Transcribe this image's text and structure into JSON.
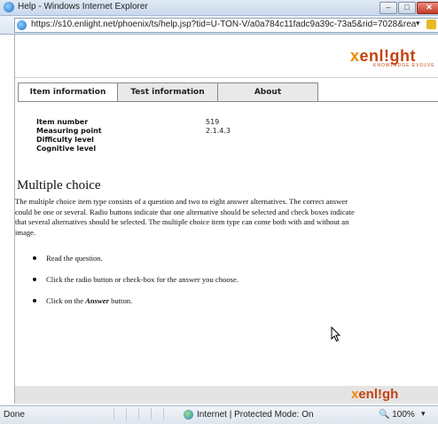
{
  "window": {
    "title": "Help - Windows Internet Explorer",
    "min_glyph": "–",
    "max_glyph": "□",
    "close_glyph": "✕"
  },
  "address": {
    "url": "https://s10.enlight.net/phoenix/ts/help.jsp?tid=U-TON-V/a0a784c11fadc9a39c-73a5&rid=7028&rea",
    "dropdown": "▾"
  },
  "brand": {
    "logo_x": "x",
    "logo_text": "enl!ght",
    "logo_sub": "KNOWLEDGE EVOLVE",
    "footer_logo_x": "x",
    "footer_logo_text": "enl!gh"
  },
  "tabs": [
    {
      "label": "Item information",
      "active": true
    },
    {
      "label": "Test information",
      "active": false
    },
    {
      "label": "About",
      "active": false
    }
  ],
  "item_info": [
    {
      "label": "Item number",
      "value": "519"
    },
    {
      "label": "Measuring point",
      "value": "2.1.4.3"
    },
    {
      "label": "Difficulty level",
      "value": ""
    },
    {
      "label": "Cognitive level",
      "value": ""
    }
  ],
  "content": {
    "heading": "Multiple choice",
    "paragraph_lines": [
      "The multiple choice item type consists of a question and two to eight answer alternatives. The correct answer",
      "could be one or several. Radio buttons indicate that one alternative should be selected and check boxes indicate",
      "that several alternatives should be selected. The multiple choice item type can come both with and without an",
      "image."
    ],
    "bullets": {
      "b1": "Read the question.",
      "b2": "Click the radio button or check-box for the answer you choose.",
      "b3_pre": "Click on the ",
      "b3_em": "Answer",
      "b3_post": " button."
    }
  },
  "status": {
    "text": "Done",
    "zone": "Internet | Protected Mode: On",
    "zoom": "🔍 100%",
    "zoom_dropdown": "▾"
  }
}
